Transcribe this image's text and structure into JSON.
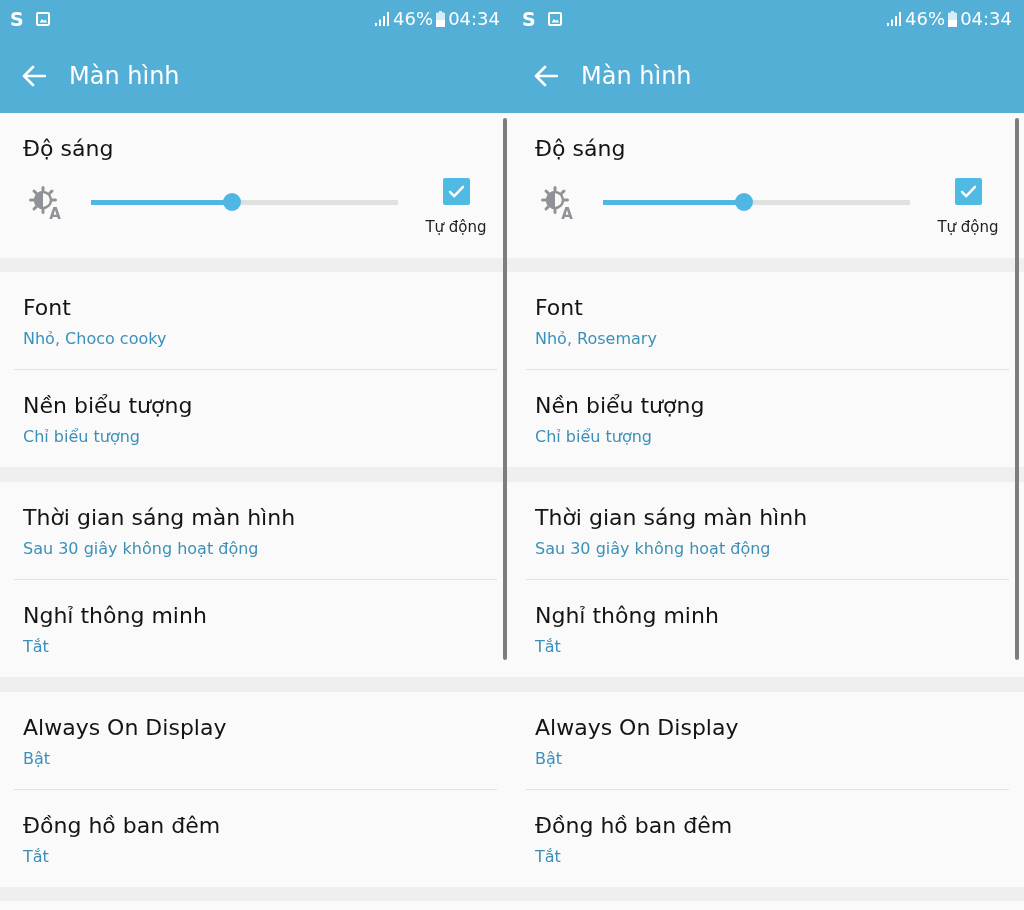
{
  "screens": [
    {
      "status_bar": {
        "notification_glyph": "S",
        "battery_percent": "46%",
        "time": "04:34"
      },
      "app_bar": {
        "title": "Màn hình"
      },
      "brightness": {
        "title": "Độ sáng",
        "icon_badge": "A",
        "level": 0.46,
        "auto": {
          "label": "Tự động",
          "checked": true
        }
      },
      "sections": [
        {
          "items": [
            {
              "title": "Font",
              "value": "Nhỏ, Choco cooky"
            },
            {
              "title": "Nền biểu tượng",
              "value": "Chỉ biểu tượng"
            }
          ]
        },
        {
          "items": [
            {
              "title": "Thời gian sáng màn hình",
              "value": "Sau 30 giây không hoạt động"
            },
            {
              "title": "Nghỉ thông minh",
              "value": "Tắt"
            }
          ]
        },
        {
          "items": [
            {
              "title": "Always On Display",
              "value": "Bật"
            },
            {
              "title": "Đồng hồ ban đêm",
              "value": "Tắt"
            }
          ]
        }
      ]
    },
    {
      "status_bar": {
        "notification_glyph": "S",
        "battery_percent": "46%",
        "time": "04:34"
      },
      "app_bar": {
        "title": "Màn hình"
      },
      "brightness": {
        "title": "Độ sáng",
        "icon_badge": "A",
        "level": 0.46,
        "auto": {
          "label": "Tự động",
          "checked": true
        }
      },
      "sections": [
        {
          "items": [
            {
              "title": "Font",
              "value": "Nhỏ, Rosemary"
            },
            {
              "title": "Nền biểu tượng",
              "value": "Chỉ biểu tượng"
            }
          ]
        },
        {
          "items": [
            {
              "title": "Thời gian sáng màn hình",
              "value": "Sau 30 giây không hoạt động"
            },
            {
              "title": "Nghỉ thông minh",
              "value": "Tắt"
            }
          ]
        },
        {
          "items": [
            {
              "title": "Always On Display",
              "value": "Bật"
            },
            {
              "title": "Đồng hồ ban đêm",
              "value": "Tắt"
            }
          ]
        }
      ]
    }
  ]
}
